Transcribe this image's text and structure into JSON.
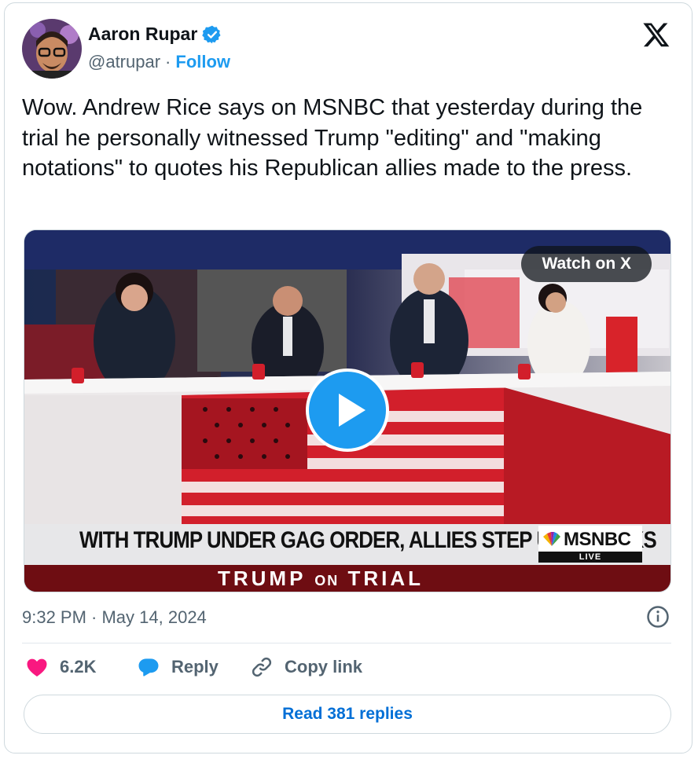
{
  "author": {
    "name": "Aaron Rupar",
    "handle": "@atrupar",
    "separator": "·",
    "follow_label": "Follow"
  },
  "tweet_text": "Wow. Andrew Rice says on MSNBC that yesterday during the trial he personally witnessed Trump \"editing\" and \"making notations\" to quotes his Republican allies made to the press.",
  "media": {
    "watch_label": "Watch on X",
    "chyron": "WITH TRUMP UNDER GAG ORDER, ALLIES STEP UP ATTACKS",
    "network": "MSNBC",
    "live": "LIVE",
    "segment_word1": "TRUMP",
    "segment_word2": "ON",
    "segment_word3": "TRIAL"
  },
  "timestamp": "9:32 PM · May 14, 2024",
  "actions": {
    "likes": "6.2K",
    "reply": "Reply",
    "copy_link": "Copy link"
  },
  "read_replies": "Read 381 replies",
  "colors": {
    "accent": "#1d9bf0",
    "like": "#f91880",
    "link": "#006fd6",
    "secondary_text": "#536471"
  },
  "icons": [
    "verified-badge-icon",
    "x-logo-icon",
    "play-icon",
    "info-icon",
    "heart-icon",
    "reply-bubble-icon",
    "link-icon"
  ]
}
